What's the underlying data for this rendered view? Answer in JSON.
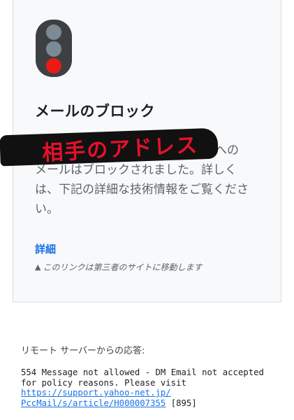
{
  "card": {
    "title": "メールのブロック",
    "redacted_handwriting": "相手のアドレス",
    "message_line1_tail": "への",
    "message_rest": "メールはブロックされました。詳しくは、下記の詳細な技術情報をご覧ください。",
    "details_link": "詳細",
    "external_note": "このリンクは第三者のサイトに移動します",
    "icons": {
      "status": "traffic-light-red-icon",
      "warning": "warning-triangle-icon"
    },
    "colors": {
      "red_lamp": "#ea1b14",
      "link": "#1a73e8",
      "handwriting": "#e8102a"
    }
  },
  "server": {
    "label": "リモート サーバーからの応答:",
    "response_text": "554 Message not allowed - DM Email not accepted for policy reasons. Please visit",
    "link_line1": "https://support.yahoo-net.jp/",
    "link_line2": "PccMail/s/article/H000007355",
    "code": "[895]"
  }
}
